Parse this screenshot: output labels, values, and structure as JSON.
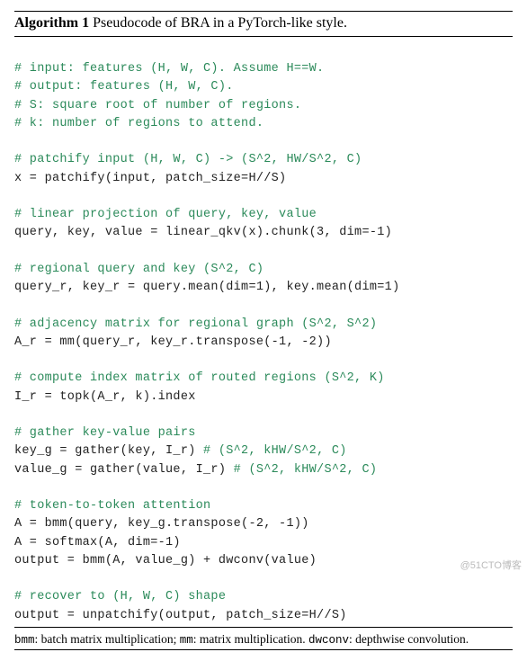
{
  "header": {
    "label": "Algorithm 1",
    "title": "Pseudocode of BRA in a PyTorch-like style."
  },
  "code": {
    "c1a": "# input: features (H, W, C). Assume H==W.",
    "c1b": "# output: features (H, W, C).",
    "c1c": "# S: square root of number of regions.",
    "c1d": "# k: number of regions to attend.",
    "c2": "# patchify input (H, W, C) -> (S^2, HW/S^2, C)",
    "l2": "x = patchify(input, patch_size=H//S)",
    "c3": "# linear projection of query, key, value",
    "l3": "query, key, value = linear_qkv(x).chunk(3, dim=-1)",
    "c4": "# regional query and key (S^2, C)",
    "l4": "query_r, key_r = query.mean(dim=1), key.mean(dim=1)",
    "c5": "# adjacency matrix for regional graph (S^2, S^2)",
    "l5": "A_r = mm(query_r, key_r.transpose(-1, -2))",
    "c6": "# compute index matrix of routed regions (S^2, K)",
    "l6": "I_r = topk(A_r, k).index",
    "c7": "# gather key-value pairs",
    "l7a": "key_g = gather(key, I_r) ",
    "c7a": "# (S^2, kHW/S^2, C)",
    "l7b": "value_g = gather(value, I_r) ",
    "c7b": "# (S^2, kHW/S^2, C)",
    "c8": "# token-to-token attention",
    "l8a": "A = bmm(query, key_g.transpose(-2, -1))",
    "l8b": "A = softmax(A, dim=-1)",
    "l8c": "output = bmm(A, value_g) + dwconv(value)",
    "c9": "# recover to (H, W, C) shape",
    "l9": "output = unpatchify(output, patch_size=H//S)"
  },
  "footer": {
    "bmm": "bmm",
    "bmm_def": ": batch matrix multiplication; ",
    "mm": "mm",
    "mm_def": ": matrix multiplication. ",
    "dwconv": "dwconv",
    "dwconv_def": ": depthwise convolution."
  },
  "watermark": "@51CTO博客"
}
